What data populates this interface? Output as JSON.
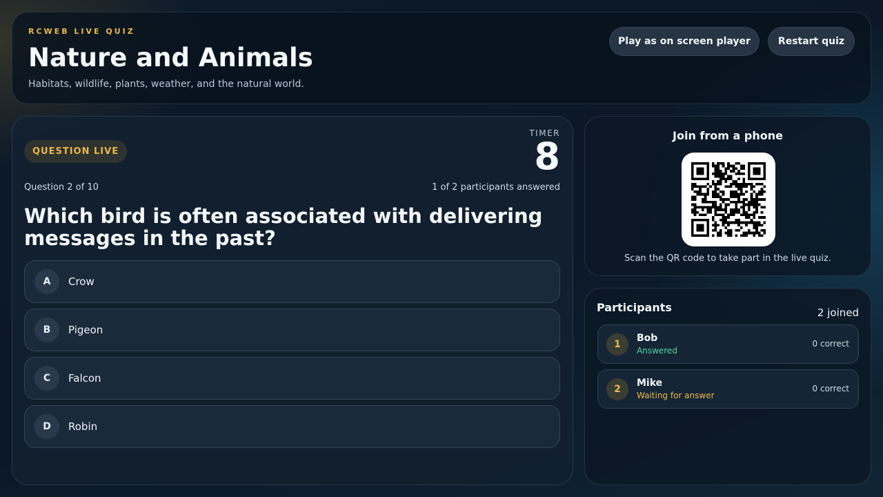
{
  "header": {
    "eyebrow": "RCWEB LIVE QUIZ",
    "title": "Nature and Animals",
    "subtitle": "Habitats, wildlife, plants, weather, and the natural world.",
    "play_button": "Play as on screen player",
    "restart_button": "Restart quiz"
  },
  "question": {
    "status": "QUESTION LIVE",
    "timer_label": "TIMER",
    "timer_value": "8",
    "progress": "Question 2 of 10",
    "answered": "1 of 2 participants answered",
    "text": "Which bird is often associated with delivering messages in the past?",
    "options": [
      {
        "letter": "A",
        "text": "Crow"
      },
      {
        "letter": "B",
        "text": "Pigeon"
      },
      {
        "letter": "C",
        "text": "Falcon"
      },
      {
        "letter": "D",
        "text": "Robin"
      }
    ]
  },
  "join": {
    "title": "Join from a phone",
    "qr_icon": "qr-code-icon",
    "caption": "Scan the QR code to take part in the live quiz."
  },
  "participants": {
    "title": "Participants",
    "joined": "2 joined",
    "list": [
      {
        "rank": "1",
        "name": "Bob",
        "status": "Answered",
        "score": "0 correct"
      },
      {
        "rank": "2",
        "name": "Mike",
        "status": "Waiting for answer",
        "score": "0 correct"
      }
    ]
  },
  "colors": {
    "accent": "#e8b84a",
    "answered": "#4cd6a0",
    "panel": "#08121e"
  }
}
